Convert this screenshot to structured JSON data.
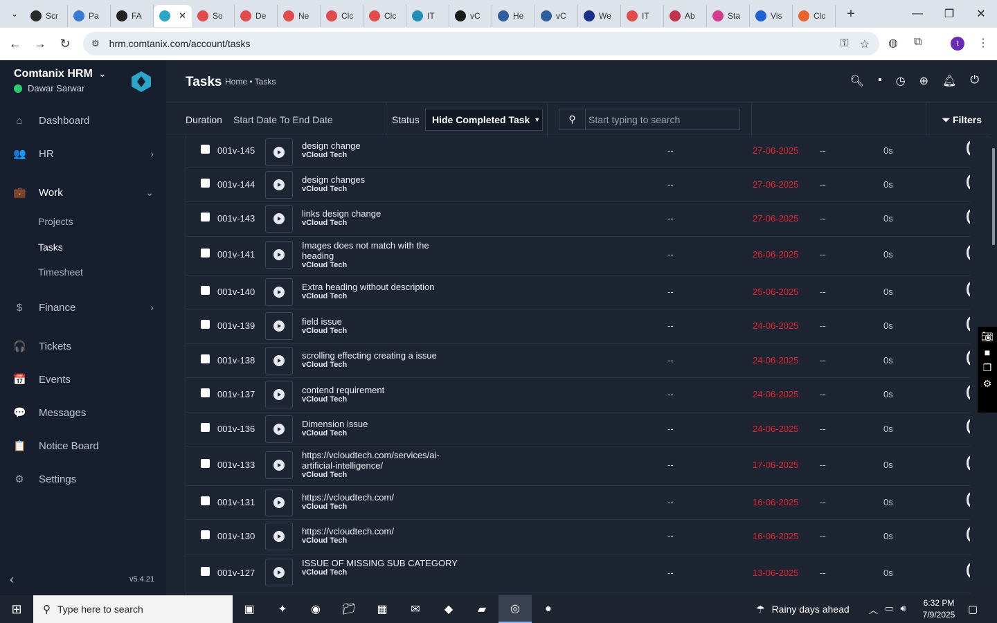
{
  "browser": {
    "tabs": [
      {
        "label": "Scr",
        "color": "#2b2b2b"
      },
      {
        "label": "Pa",
        "color": "#3b7bd4"
      },
      {
        "label": "FA",
        "color": "#222222"
      },
      {
        "label": "",
        "color": "#2aa6c9",
        "active": true
      },
      {
        "label": "So",
        "color": "#e14b4b"
      },
      {
        "label": "De",
        "color": "#e14b4b"
      },
      {
        "label": "Ne",
        "color": "#e14b4b"
      },
      {
        "label": "Clc",
        "color": "#e14b4b"
      },
      {
        "label": "Clc",
        "color": "#e14b4b"
      },
      {
        "label": "IT",
        "color": "#1f8fb3"
      },
      {
        "label": "vC",
        "color": "#1b1b1b"
      },
      {
        "label": "He",
        "color": "#2f5f9e"
      },
      {
        "label": "vC",
        "color": "#2f5f9e"
      },
      {
        "label": "We",
        "color": "#1a2f8a"
      },
      {
        "label": "IT",
        "color": "#e14b4b"
      },
      {
        "label": "Ab",
        "color": "#c0344a"
      },
      {
        "label": "Sta",
        "color": "#d43b8c"
      },
      {
        "label": "Vis",
        "color": "#1e5fd6"
      },
      {
        "label": "Clc",
        "color": "#e8632a"
      }
    ],
    "new_tab": "+",
    "url": "hrm.comtanix.com/account/tasks",
    "profile_initial": "t"
  },
  "sidebar": {
    "brand": "Comtanix HRM",
    "user": "Dawar Sarwar",
    "items": [
      {
        "label": "Dashboard",
        "icon": "⌂"
      },
      {
        "label": "HR",
        "icon": "👥"
      },
      {
        "label": "Work",
        "icon": "💼"
      },
      {
        "label": "Finance",
        "icon": "$"
      },
      {
        "label": "Tickets",
        "icon": "🎧"
      },
      {
        "label": "Events",
        "icon": "📅"
      },
      {
        "label": "Messages",
        "icon": "💬"
      },
      {
        "label": "Notice Board",
        "icon": "📋"
      },
      {
        "label": "Settings",
        "icon": "⚙"
      }
    ],
    "work_sub": [
      "Projects",
      "Tasks",
      "Timesheet"
    ],
    "version": "v5.4.21"
  },
  "header": {
    "title": "Tasks",
    "breadcrumb": "Home • Tasks"
  },
  "filters": {
    "duration_label": "Duration",
    "date_range": "Start Date To End Date",
    "status_label": "Status",
    "status_value": "Hide Completed Task",
    "search_placeholder": "Start typing to search",
    "filters_label": "Filters"
  },
  "tasks": [
    {
      "id": "001v-145",
      "name": "design change",
      "project": "vCloud Tech",
      "col1": "--",
      "due": "27-06-2025",
      "col2": "--",
      "time": "0s"
    },
    {
      "id": "001v-144",
      "name": "design changes",
      "project": "vCloud Tech",
      "col1": "--",
      "due": "27-06-2025",
      "col2": "--",
      "time": "0s"
    },
    {
      "id": "001v-143",
      "name": "links design change",
      "project": "vCloud Tech",
      "col1": "--",
      "due": "27-06-2025",
      "col2": "--",
      "time": "0s"
    },
    {
      "id": "001v-141",
      "name": "Images does not match with the heading",
      "project": "vCloud Tech",
      "col1": "--",
      "due": "26-06-2025",
      "col2": "--",
      "time": "0s"
    },
    {
      "id": "001v-140",
      "name": "Extra heading without description",
      "project": "vCloud Tech",
      "col1": "--",
      "due": "25-06-2025",
      "col2": "--",
      "time": "0s"
    },
    {
      "id": "001v-139",
      "name": "field issue",
      "project": "vCloud Tech",
      "col1": "--",
      "due": "24-06-2025",
      "col2": "--",
      "time": "0s"
    },
    {
      "id": "001v-138",
      "name": "scrolling effecting creating a issue",
      "project": "vCloud Tech",
      "col1": "--",
      "due": "24-06-2025",
      "col2": "--",
      "time": "0s"
    },
    {
      "id": "001v-137",
      "name": "contend requirement",
      "project": "vCloud Tech",
      "col1": "--",
      "due": "24-06-2025",
      "col2": "--",
      "time": "0s"
    },
    {
      "id": "001v-136",
      "name": "Dimension issue",
      "project": "vCloud Tech",
      "col1": "--",
      "due": "24-06-2025",
      "col2": "--",
      "time": "0s"
    },
    {
      "id": "001v-133",
      "name": "https://vcloudtech.com/services/ai-artificial-intelligence/",
      "project": "vCloud Tech",
      "col1": "--",
      "due": "17-06-2025",
      "col2": "--",
      "time": "0s"
    },
    {
      "id": "001v-131",
      "name": "https://vcloudtech.com/",
      "project": "vCloud Tech",
      "col1": "--",
      "due": "16-06-2025",
      "col2": "--",
      "time": "0s"
    },
    {
      "id": "001v-130",
      "name": "https://vcloudtech.com/",
      "project": "vCloud Tech",
      "col1": "--",
      "due": "16-06-2025",
      "col2": "--",
      "time": "0s"
    },
    {
      "id": "001v-127",
      "name": "ISSUE OF MISSING SUB CATEGORY",
      "project": "vCloud Tech",
      "col1": "--",
      "due": "13-06-2025",
      "col2": "--",
      "time": "0s"
    }
  ],
  "taskbar": {
    "search_placeholder": "Type here to search",
    "weather": "Rainy days ahead",
    "time": "6:32 PM",
    "date": "7/9/2025"
  },
  "colors": {
    "accent": "#2aa6c9",
    "due_date": "#e4252b",
    "online": "#2ecc71"
  }
}
